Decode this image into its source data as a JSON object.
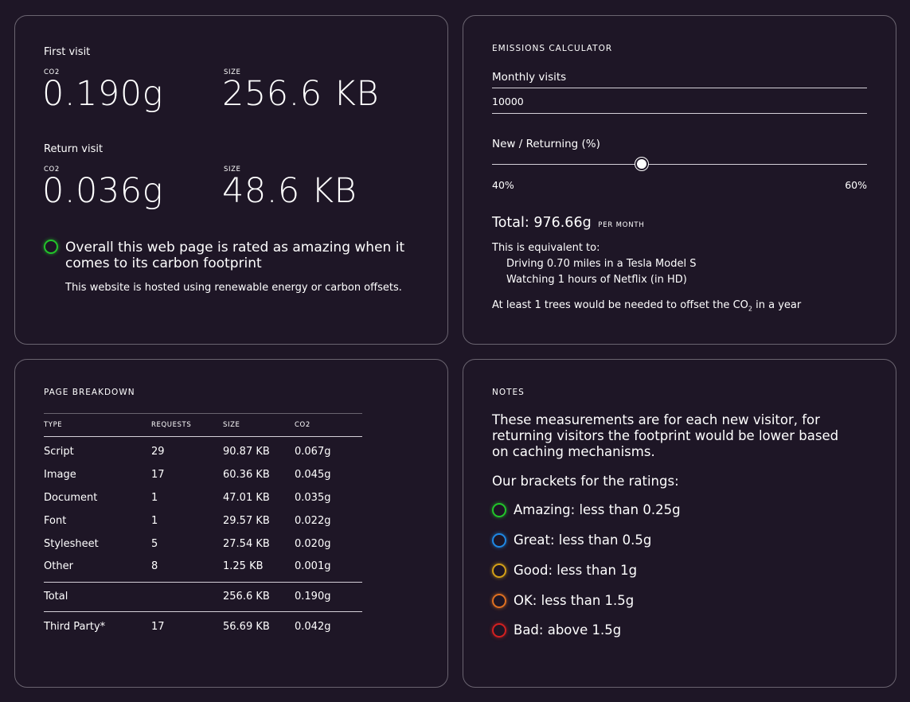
{
  "summary": {
    "first_visit": {
      "heading": "First visit",
      "co2_label": "CO2",
      "co2_value": "0.190g",
      "size_label": "SIZE",
      "size_value": "256.6 KB"
    },
    "return_visit": {
      "heading": "Return visit",
      "co2_label": "CO2",
      "co2_value": "0.036g",
      "size_label": "SIZE",
      "size_value": "48.6 KB"
    },
    "rating_line1": "Overall this web page is rated as amazing when it",
    "rating_line2": "comes to its carbon footprint",
    "rating_color": "#22c52a",
    "hosting_note": "This website is hosted using renewable energy or carbon offsets."
  },
  "calculator": {
    "heading": "EMISSIONS CALCULATOR",
    "monthly_visits_label": "Monthly visits",
    "monthly_visits_value": "10000",
    "ratio_label": "New / Returning (%)",
    "new_pct_label": "40%",
    "returning_pct_label": "60%",
    "new_fraction": 0.4,
    "total_prefix": "Total: ",
    "total_value": "976.66g",
    "total_unit": "PER MONTH",
    "equivalent_heading": "This is equivalent to:",
    "equivalents": [
      "Driving 0.70 miles in a Tesla Model S",
      "Watching 1 hours of Netflix (in HD)"
    ],
    "trees_prefix": "At least 1 trees would be needed to offset the CO",
    "trees_sub": "2",
    "trees_suffix": " in a year"
  },
  "breakdown": {
    "heading": "PAGE BREAKDOWN",
    "columns": [
      "TYPE",
      "REQUESTS",
      "SIZE",
      "CO2"
    ],
    "rows": [
      [
        "Script",
        "29",
        "90.87 KB",
        "0.067g"
      ],
      [
        "Image",
        "17",
        "60.36 KB",
        "0.045g"
      ],
      [
        "Document",
        "1",
        "47.01 KB",
        "0.035g"
      ],
      [
        "Font",
        "1",
        "29.57 KB",
        "0.022g"
      ],
      [
        "Stylesheet",
        "5",
        "27.54 KB",
        "0.020g"
      ],
      [
        "Other",
        "8",
        "1.25 KB",
        "0.001g"
      ]
    ],
    "total_row": [
      "Total",
      "",
      "256.6 KB",
      "0.190g"
    ],
    "third_party_row": [
      "Third Party*",
      "17",
      "56.69 KB",
      "0.042g"
    ]
  },
  "notes": {
    "heading": "NOTES",
    "paragraph_lines": [
      "These measurements are for each new visitor, for",
      "returning visitors the footprint would be lower based",
      "on caching mechanisms."
    ],
    "brackets_heading": "Our brackets for the ratings:",
    "brackets": [
      {
        "label": "Amazing: less than 0.25g",
        "color": "#22c52a"
      },
      {
        "label": "Great: less than 0.5g",
        "color": "#1e88e5"
      },
      {
        "label": "Good: less than 1g",
        "color": "#d4a017"
      },
      {
        "label": "OK: less than 1.5g",
        "color": "#e07020"
      },
      {
        "label": "Bad: above 1.5g",
        "color": "#d32020"
      }
    ]
  }
}
